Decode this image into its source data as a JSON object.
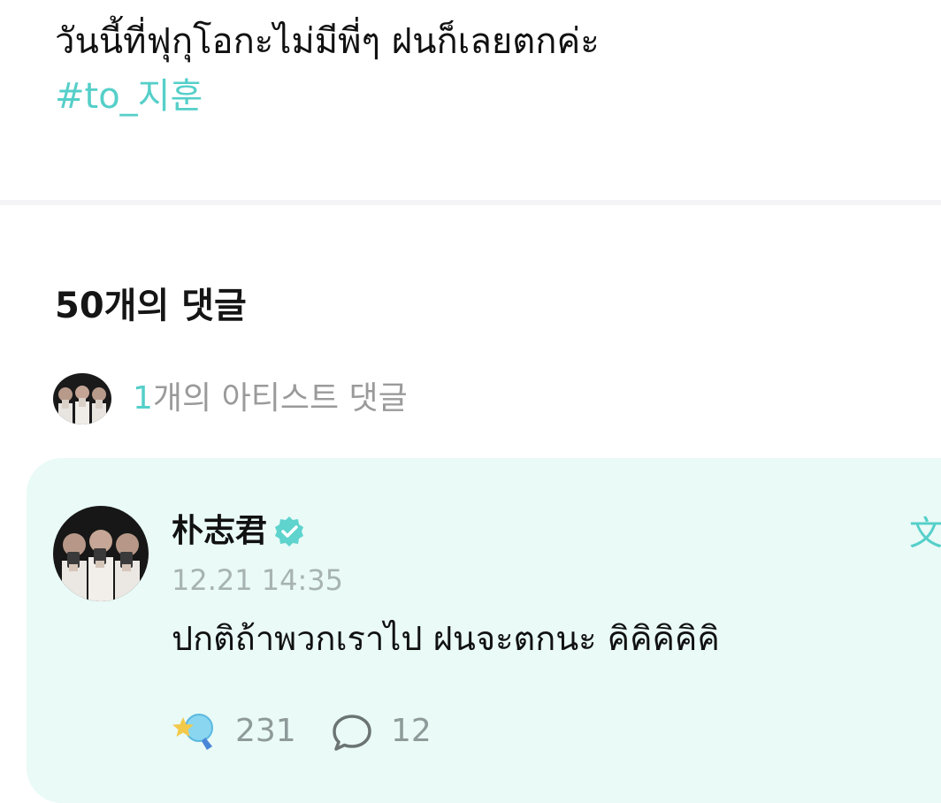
{
  "post": {
    "text": "วันนี้ที่ฟุกุโอกะไม่มีพี่ๆ ฝนก็เลยตกค่ะ",
    "hashtag": "#to_지훈"
  },
  "comments_section": {
    "heading": "50개의 댓글",
    "artist_comments": {
      "count": "1",
      "label": "개의 아티스트 댓글"
    }
  },
  "artist_comment": {
    "author": "朴志君",
    "verified_icon": "verified-badge-icon",
    "translate_label": "文",
    "timestamp": "12.21 14:35",
    "text": "ปกติถ้าพวกเราไป ฝนจะตกนะ คิคิคิคิคิ",
    "cheer_icon": "star-cheer-icon",
    "cheer_count": "231",
    "reply_icon": "speech-bubble-icon",
    "reply_count": "12"
  },
  "colors": {
    "accent": "#55cfc9",
    "card_background": "#e9faf7",
    "muted_text": "#9a9a9a"
  }
}
